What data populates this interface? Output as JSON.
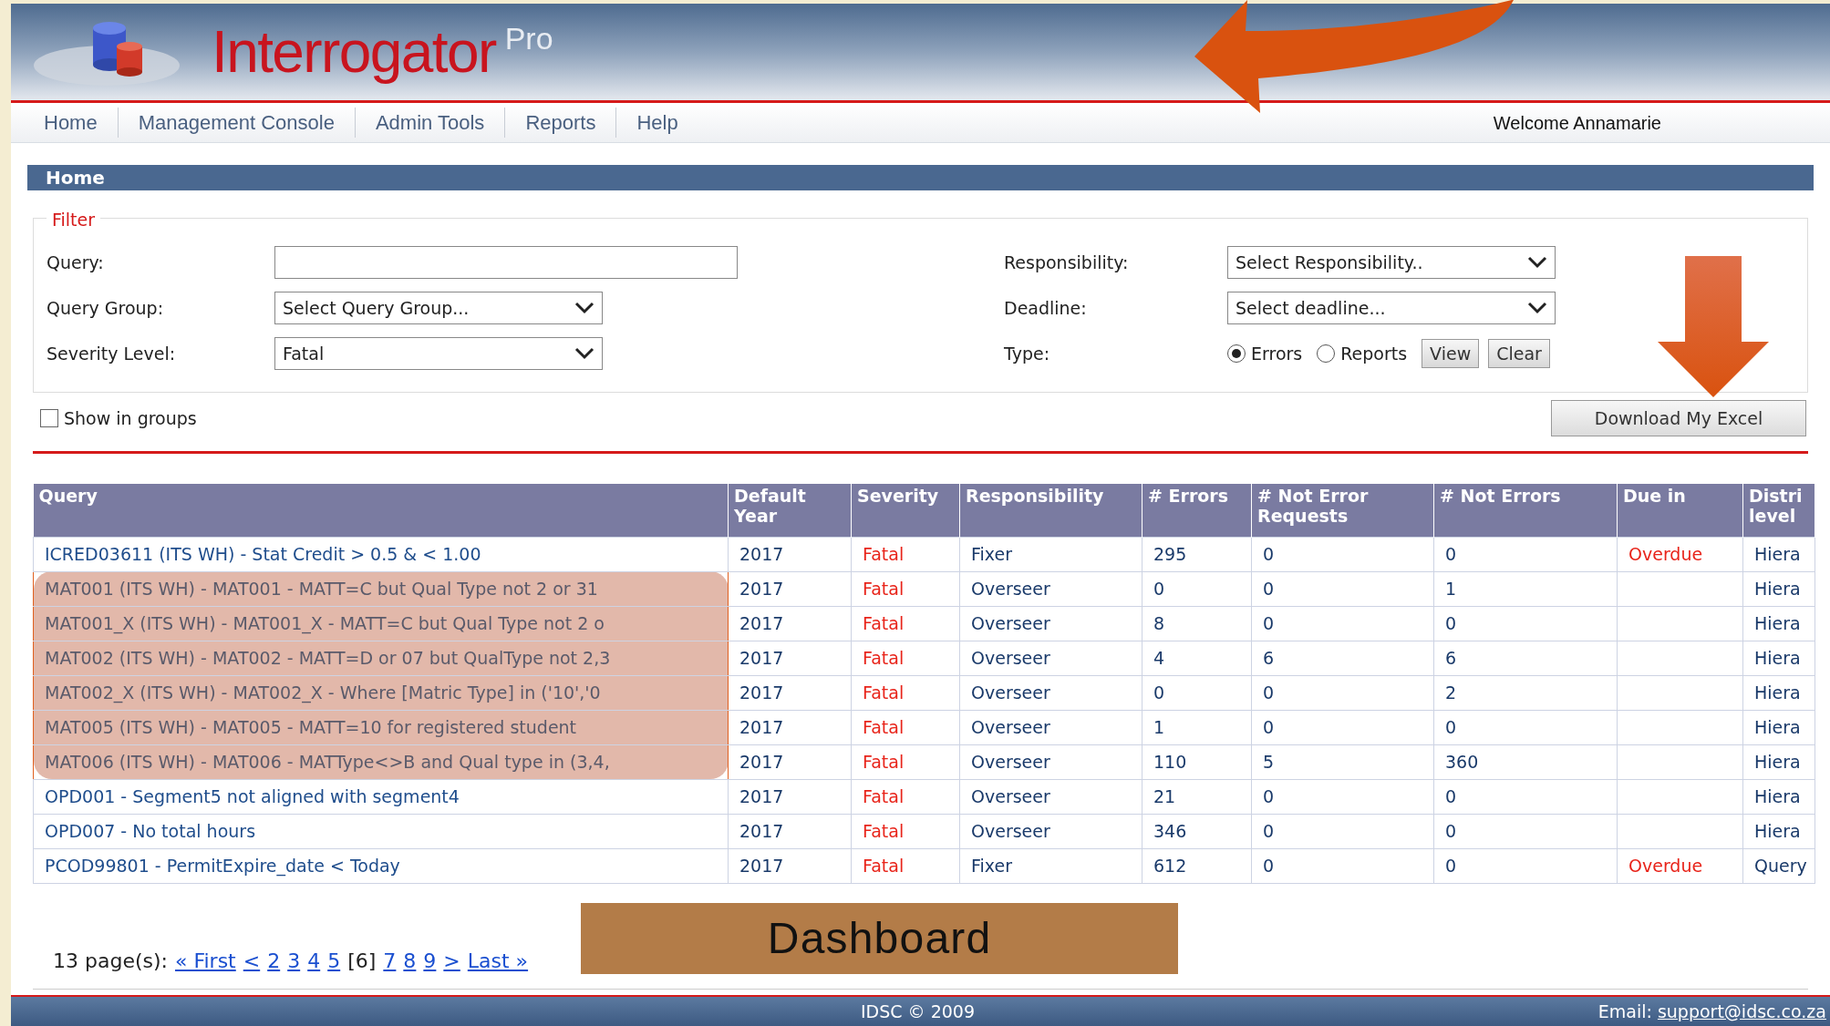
{
  "header": {
    "title": "Interrogator",
    "title_suffix": "Pro"
  },
  "nav": [
    {
      "label": "Home"
    },
    {
      "label": "Management Console"
    },
    {
      "label": "Admin Tools"
    },
    {
      "label": "Reports"
    },
    {
      "label": "Help"
    }
  ],
  "welcome": "Welcome Annamarie",
  "page_title": "Home",
  "filter": {
    "legend": "Filter",
    "query": {
      "label": "Query:"
    },
    "query_group": {
      "label": "Query Group:",
      "value": "Select Query Group..."
    },
    "severity_level": {
      "label": "Severity Level:",
      "value": "Fatal"
    },
    "responsibility": {
      "label": "Responsibility:",
      "value": "Select Responsibility.."
    },
    "deadline": {
      "label": "Deadline:",
      "value": "Select deadline..."
    },
    "type": {
      "label": "Type:",
      "options": [
        {
          "label": "Errors",
          "selected": true
        },
        {
          "label": "Reports",
          "selected": false
        }
      ]
    },
    "buttons": [
      "View",
      "Clear"
    ]
  },
  "show_in_groups": {
    "label": "Show in groups",
    "checked": false
  },
  "download_button": "Download My Excel",
  "table": {
    "columns": [
      {
        "label": "Query",
        "kind": "query"
      },
      {
        "label": "Default Year",
        "kind": "text"
      },
      {
        "label": "Severity",
        "kind": "severity"
      },
      {
        "label": "Responsibility",
        "kind": "text"
      },
      {
        "label": "# Errors",
        "kind": "text"
      },
      {
        "label": "# Not Error Requests",
        "kind": "text"
      },
      {
        "label": "# Not Errors",
        "kind": "text"
      },
      {
        "label": "Due in",
        "kind": "due"
      },
      {
        "label": "Distri level",
        "kind": "text"
      }
    ],
    "rows": [
      {
        "highlighted": false,
        "cells": [
          "ICRED03611 (ITS WH) - Stat Credit > 0.5 & < 1.00",
          "2017",
          "Fatal",
          "Fixer",
          "295",
          "0",
          "0",
          "Overdue",
          "Hiera"
        ]
      },
      {
        "highlighted": true,
        "cells": [
          "MAT001 (ITS WH) - MAT001 - MATT=C but Qual Type not 2 or 31",
          "2017",
          "Fatal",
          "Overseer",
          "0",
          "0",
          "1",
          "",
          "Hiera"
        ]
      },
      {
        "highlighted": true,
        "cells": [
          "MAT001_X (ITS WH) - MAT001_X - MATT=C but Qual Type not 2 o",
          "2017",
          "Fatal",
          "Overseer",
          "8",
          "0",
          "0",
          "",
          "Hiera"
        ]
      },
      {
        "highlighted": true,
        "cells": [
          "MAT002 (ITS WH) - MAT002 - MATT=D or 07 but QualType not 2,3",
          "2017",
          "Fatal",
          "Overseer",
          "4",
          "6",
          "6",
          "",
          "Hiera"
        ]
      },
      {
        "highlighted": true,
        "cells": [
          "MAT002_X (ITS WH) - MAT002_X - Where [Matric Type] in ('10','0",
          "2017",
          "Fatal",
          "Overseer",
          "0",
          "0",
          "2",
          "",
          "Hiera"
        ]
      },
      {
        "highlighted": true,
        "cells": [
          "MAT005 (ITS WH) - MAT005 - MATT=10 for registered student",
          "2017",
          "Fatal",
          "Overseer",
          "1",
          "0",
          "0",
          "",
          "Hiera"
        ]
      },
      {
        "highlighted": true,
        "cells": [
          "MAT006 (ITS WH) - MAT006 - MATType<>B and Qual type in (3,4,",
          "2017",
          "Fatal",
          "Overseer",
          "110",
          "5",
          "360",
          "",
          "Hiera"
        ]
      },
      {
        "highlighted": false,
        "cells": [
          "OPD001 - Segment5 not aligned with segment4",
          "2017",
          "Fatal",
          "Overseer",
          "21",
          "0",
          "0",
          "",
          "Hiera"
        ]
      },
      {
        "highlighted": false,
        "cells": [
          "OPD007 - No total hours",
          "2017",
          "Fatal",
          "Overseer",
          "346",
          "0",
          "0",
          "",
          "Hiera"
        ]
      },
      {
        "highlighted": false,
        "cells": [
          "PCOD99801 - PermitExpire_date < Today",
          "2017",
          "Fatal",
          "Fixer",
          "612",
          "0",
          "0",
          "Overdue",
          "Query"
        ]
      }
    ]
  },
  "pagination": {
    "summary": "13 page(s):",
    "links": [
      {
        "label": "« First",
        "current": false
      },
      {
        "label": "<",
        "current": false
      },
      {
        "label": "2",
        "current": false
      },
      {
        "label": "3",
        "current": false
      },
      {
        "label": "4",
        "current": false
      },
      {
        "label": "5",
        "current": false
      },
      {
        "label": "[6]",
        "current": true
      },
      {
        "label": "7",
        "current": false
      },
      {
        "label": "8",
        "current": false
      },
      {
        "label": "9",
        "current": false
      },
      {
        "label": ">",
        "current": false
      },
      {
        "label": "Last »",
        "current": false
      }
    ]
  },
  "annotation": {
    "label": "Dashboard"
  },
  "footer": {
    "copyright": "IDSC © 2009",
    "email_label": "Email:",
    "email": "support@idsc.co.za"
  }
}
